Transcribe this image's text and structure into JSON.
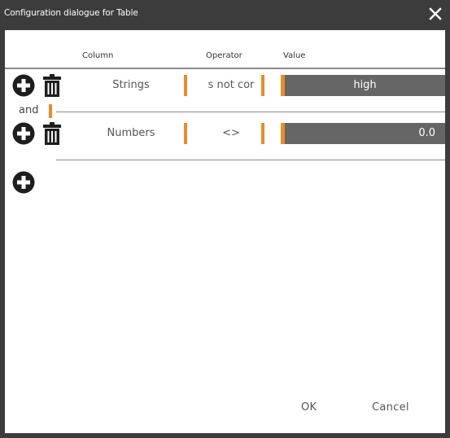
{
  "window": {
    "title": "Configuration dialogue for Table",
    "close_icon": "close-icon"
  },
  "headers": {
    "column": "Column",
    "operator": "Operator",
    "value": "Value"
  },
  "conditions": [
    {
      "column": "Strings",
      "operator": "s not cor",
      "value": "high",
      "value_align": "center"
    },
    {
      "column": "Numbers",
      "operator": "<>",
      "value": "0.0",
      "value_align": "right"
    }
  ],
  "connector": "and",
  "icons": {
    "add": "plus-circle-icon",
    "delete": "trash-icon"
  },
  "colors": {
    "accent": "#e88d2a",
    "value_bg": "#666666",
    "chrome": "#3c3c3c"
  },
  "buttons": {
    "ok": "OK",
    "cancel": "Cancel"
  }
}
